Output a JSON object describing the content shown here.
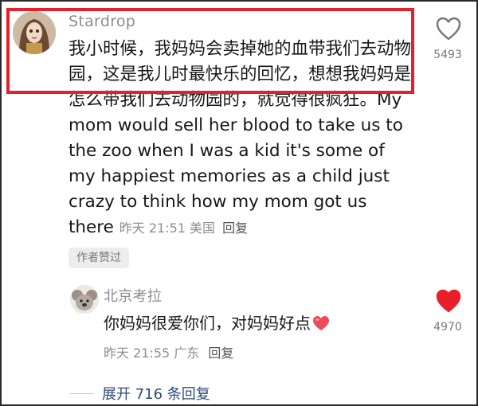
{
  "comment": {
    "username": "Stardrop",
    "text": "我小时候，我妈妈会卖掉她的血带我们去动物园，这是我儿时最快乐的回忆，想想我妈妈是怎么带我们去动物园的，就觉得很疯狂。My mom would sell her blood to take us to the zoo when I was a kid it's some of my happiest memories as a child just crazy to think how my mom got us there",
    "meta": "昨天 21:51 美国",
    "reply_label": "回复",
    "author_badge": "作者赞过",
    "like_count": "5493",
    "liked": false
  },
  "reply": {
    "username": "北京考拉",
    "text": "你妈妈很爱你们，对妈妈好点",
    "emoji": "red-heart",
    "meta": "昨天 21:55 广东",
    "reply_label": "回复",
    "like_count": "4970",
    "liked": true
  },
  "expand_label": "展开 716 条回复",
  "colors": {
    "highlight": "#e5202a",
    "liked_heart": "#e8202a",
    "expand_link": "#2e4a7a"
  }
}
